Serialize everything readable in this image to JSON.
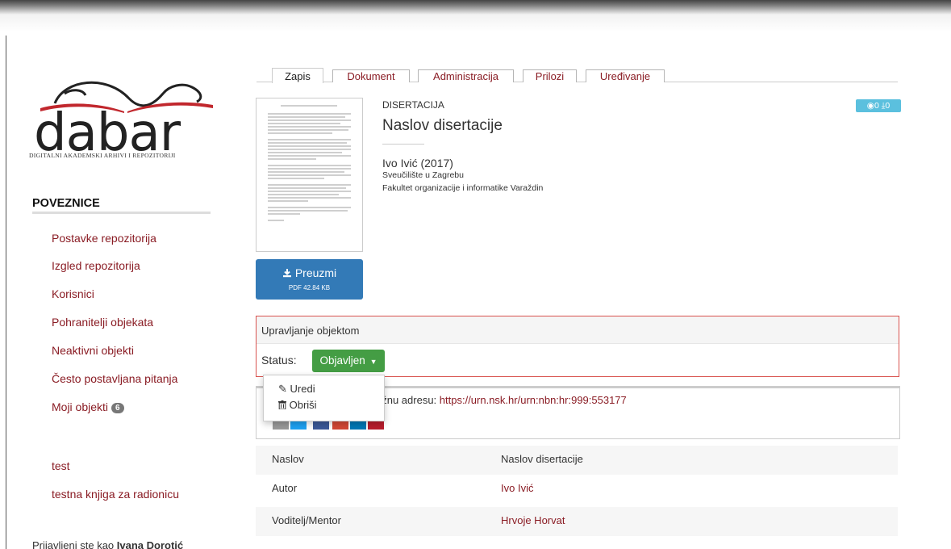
{
  "logo": {
    "wordmark": "dabar",
    "subtitle": "DIGITALNI AKADEMSKI ARHIVI I REPOZITORIJI"
  },
  "sidebar": {
    "heading": "POVEZNICE",
    "links": [
      {
        "label": "Postavke repozitorija"
      },
      {
        "label": "Izgled repozitorija"
      },
      {
        "label": "Korisnici"
      },
      {
        "label": "Pohranitelji objekata"
      },
      {
        "label": "Neaktivni objekti"
      },
      {
        "label": "Često postavljana pitanja"
      },
      {
        "label": "Moji objekti",
        "badge": "6"
      }
    ],
    "extra_links": [
      {
        "label": "test"
      },
      {
        "label": "testna knjiga za radionicu"
      }
    ],
    "login_prefix": "Prijavljeni ste kao ",
    "login_user": "Ivana Dorotić"
  },
  "tabs": [
    {
      "label": "Zapis",
      "active": true
    },
    {
      "label": "Dokument"
    },
    {
      "label": "Administracija"
    },
    {
      "label": "Prilozi"
    },
    {
      "label": "Uređivanje"
    }
  ],
  "record": {
    "type": "DISERTACIJA",
    "title": "Naslov disertacije",
    "author_year": "Ivo Ivić (2017)",
    "institution": "Sveučilište u Zagrebu",
    "faculty": "Fakultet organizacije i informatike Varaždin",
    "stats": {
      "views": "0",
      "downloads": "0"
    },
    "download": {
      "label": "Preuzmi",
      "size": "PDF 42.84 KB"
    }
  },
  "management": {
    "title": "Upravljanje objektom",
    "status_label": "Status:",
    "status_value": "Objavljen",
    "dropdown": [
      {
        "label": "Uredi",
        "icon": "edit-icon"
      },
      {
        "label": "Obriši",
        "icon": "trash-icon"
      }
    ]
  },
  "urn": {
    "text_fragment": "u mrežnu adresu: ",
    "url": "https://urn.nsk.hr/urn:nbn:hr:999:553177"
  },
  "metadata": [
    {
      "label": "Naslov",
      "value": "Naslov disertacije",
      "link": false
    },
    {
      "label": "Autor",
      "value": "Ivo Ivić",
      "link": true
    },
    {
      "label": "Voditelj/Mentor",
      "value": "Hrvoje Horvat",
      "link": true
    }
  ],
  "colors": {
    "link": "#8a1c24",
    "primary": "#337ab7",
    "success": "#449d44",
    "danger_border": "#d9534f",
    "info": "#5bc0de"
  }
}
